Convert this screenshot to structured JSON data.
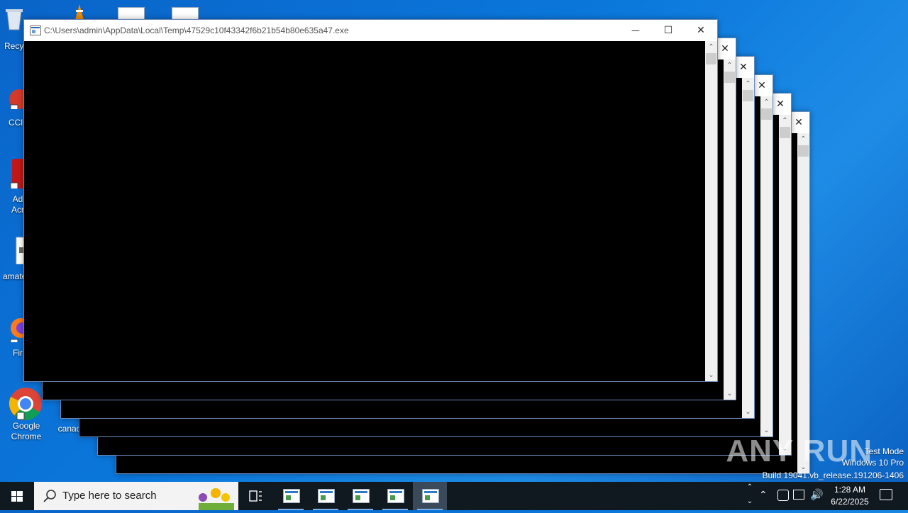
{
  "desktop": {
    "icons": [
      {
        "label": "Recy",
        "icon": "recycle-bin-icon"
      },
      {
        "label": "CCl",
        "icon": "ccleaner-icon"
      },
      {
        "label": "Ad\nAcr",
        "icon": "acrobat-icon"
      },
      {
        "label": "amate",
        "icon": "document-icon"
      },
      {
        "label": "Fir",
        "icon": "firefox-icon"
      },
      {
        "label": "Google Chrome",
        "icon": "chrome-icon"
      },
      {
        "label": "canad",
        "icon": "document-icon"
      }
    ]
  },
  "window": {
    "title": "C:\\Users\\admin\\AppData\\Local\\Temp\\47529c10f43342f6b21b54b80e635a47.exe",
    "minimize": "—",
    "maximize": "☐",
    "close": "✕",
    "scroll_up": "⌃",
    "scroll_down": "⌄"
  },
  "stacked_windows_close": "✕",
  "watermark": {
    "logo": "ANY RUN",
    "test_mode": "Test Mode",
    "os": "Windows 10 Pro",
    "build": "Build 19041.vb_release.191206-1406"
  },
  "taskbar": {
    "search_placeholder": "Type here to search",
    "time": "1:28 AM",
    "date": "6/22/2025"
  },
  "colors": {
    "desktop_blue": "#0b78dc",
    "taskbar": "#101820",
    "console_bg": "#000000"
  }
}
